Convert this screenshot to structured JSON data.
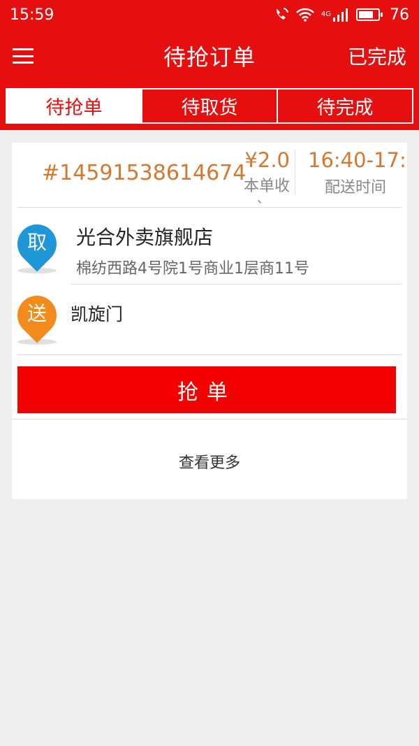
{
  "status_bar": {
    "time": "15:59",
    "network": "4G",
    "battery": "76"
  },
  "app_bar": {
    "title": "待抢订单",
    "right_action": "已完成"
  },
  "tabs": [
    {
      "label": "待抢单",
      "active": true
    },
    {
      "label": "待取货",
      "active": false
    },
    {
      "label": "待完成",
      "active": false
    }
  ],
  "order": {
    "id": "#14591538614674",
    "fee": "¥2.0",
    "fee_label": "本单收",
    "fee_extra": "、",
    "delivery_time": "16:40-17:",
    "delivery_time_label": "配送时间",
    "pickup": {
      "icon_text": "取",
      "name": "光合外卖旗舰店",
      "address": "棉纺西路4号院1号商业1层商11号"
    },
    "dropoff": {
      "icon_text": "送",
      "name": "凯旋门"
    },
    "grab_button": "抢单",
    "more_link": "查看更多"
  },
  "colors": {
    "brand_red": "#e50f10",
    "button_red": "#f50000",
    "accent_orange": "#d4782f",
    "pickup_blue": "#1e96d7",
    "dropoff_orange": "#f38a1c"
  }
}
